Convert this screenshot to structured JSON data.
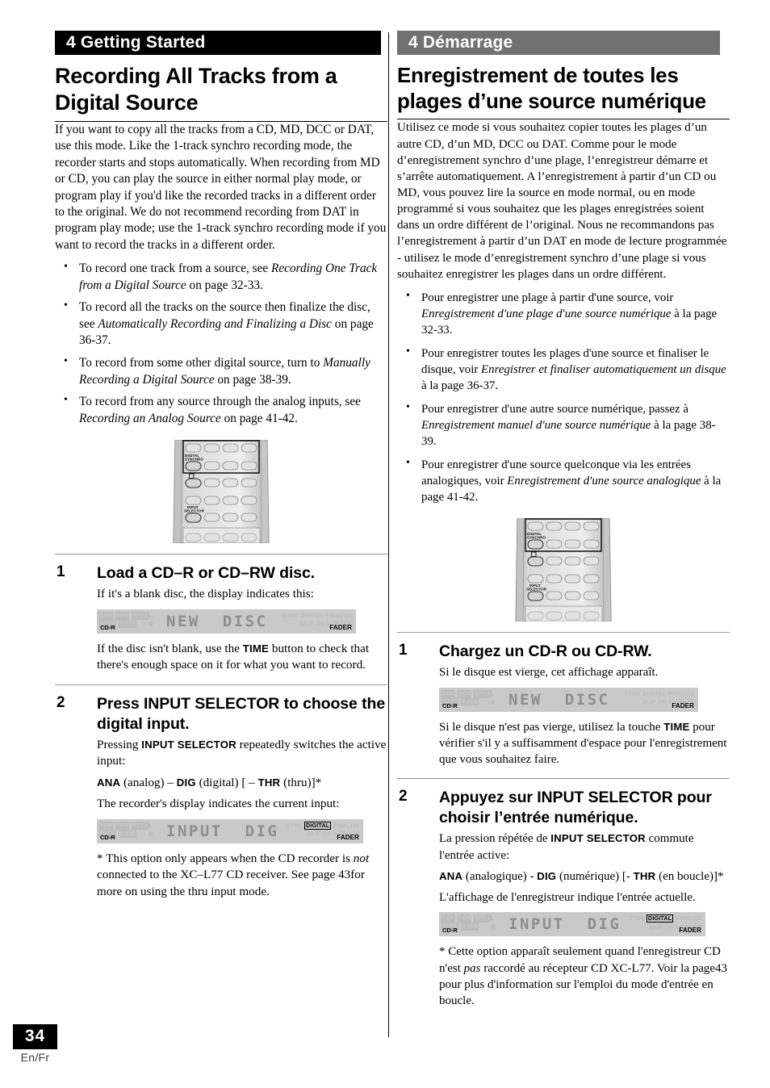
{
  "page": {
    "number": "34",
    "language_code": "En/Fr"
  },
  "columns": {
    "english": {
      "banner": "4 Getting Started",
      "banner_bg": "#000000",
      "title": "Recording All Tracks from a Digital Source",
      "intro": "If you want to copy all the tracks from a CD, MD, DCC or DAT, use this mode. Like the 1-track synchro recording mode, the recorder starts and stops automatically. When recording from MD or CD, you can play the source in either normal play mode, or program play if you'd like the recorded tracks in a different order to the original. We do not recommend recording from DAT in program play mode; use the 1-track synchro recording mode if you want to record the tracks in a different order.",
      "bullets": [
        {
          "pre": "To record one track from a source, see ",
          "italic": "Recording One Track from a Digital Source",
          "post": " on page 32-33."
        },
        {
          "pre": "To record all the tracks on the source then finalize the disc, see ",
          "italic": "Automatically Recording and Finalizing a Disc",
          "post": " on page 36-37."
        },
        {
          "pre": "To record from some other digital source, turn to ",
          "italic": "Manually Recording a Digital Source",
          "post": " on page 38-39."
        },
        {
          "pre": "To record from any source through the analog inputs, see ",
          "italic": "Recording an Analog Source",
          "post": " on page 41-42."
        }
      ],
      "steps": [
        {
          "number": "1",
          "title": "Load a CD–R or CD–RW disc.",
          "lead": "If it's a blank disc, the display indicates this:",
          "after_pre": "If the disc isn't blank, use the ",
          "after_bold": "TIME",
          "after_post": " button to check that there's enough space on it for what you want to record."
        },
        {
          "number": "2",
          "title": "Press INPUT SELECTOR to choose the digital input.",
          "lead_pre": "Pressing ",
          "lead_bold": "INPUT SELECTOR",
          "lead_post": " repeatedly switches the active input:",
          "sequence": {
            "ana": "ANA",
            "ana_note": " (analog) – ",
            "dig": "DIG",
            "dig_note": " (digital) [ – ",
            "thr": "THR",
            "thr_note": " (thru)]*"
          },
          "lead2": "The recorder's display indicates the current input:",
          "footnote_pre": "* This option only appears when the CD recorder is ",
          "footnote_italic": "not",
          "footnote_post": " connected to the XC–L77 CD receiver. See page 43for more on using the thru input mode."
        }
      ]
    },
    "french": {
      "banner": "4 Démarrage",
      "banner_bg": "#717171",
      "title": "Enregistrement de toutes les plages d’une source numérique",
      "intro": "Utilisez ce mode si vous souhaitez copier toutes les plages d’un autre CD, d’un MD, DCC ou DAT. Comme pour le mode d’enregistrement synchro d’une plage, l’enregistreur démarre et s’arrête automatiquement. A l’enregistrement à partir d’un CD ou MD, vous pouvez lire la source en mode normal, ou en mode programmé si vous souhaitez que les plages enregistrées soient dans un ordre différent de l’original. Nous ne recommandons pas l’enregistrement à partir d’un DAT en mode de lecture programmée - utilisez le mode d’enregistrement synchro d’une plage si vous souhaitez enregistrer les plages dans un ordre différent.",
      "bullets": [
        {
          "pre": "Pour enregistrer une plage à partir d'une source, voir ",
          "italic": "Enregistrement d'une plage d'une source numérique",
          "post": " à la page 32-33."
        },
        {
          "pre": "Pour enregistrer toutes les plages d'une source et finaliser le disque, voir ",
          "italic": "Enregistrer et finaliser automatiquement un disque",
          "post": " à la page 36-37."
        },
        {
          "pre": "Pour enregistrer d'une autre source numérique, passez à ",
          "italic": "Enregistrement manuel d'une source numérique",
          "post": " à la page 38-39."
        },
        {
          "pre": "Pour enregistrer d'une source quelconque via les entrées analogiques, voir ",
          "italic": "Enregistrement d'une source analogique",
          "post": " à la page 41-42."
        }
      ],
      "steps": [
        {
          "number": "1",
          "title": "Chargez un CD-R ou CD-RW.",
          "lead": "Si le disque est vierge, cet affichage apparaît.",
          "after_pre": "Si le disque n'est pas vierge, utilisez la touche ",
          "after_bold": "TIME",
          "after_post": " pour vérifier s'il y a suffisamment d'espace pour l'enregistrement que vous souhaitez faire."
        },
        {
          "number": "2",
          "title": "Appuyez sur INPUT SELECTOR pour choisir l’entrée numérique.",
          "lead_pre": "La pression répétée de ",
          "lead_bold": "INPUT SELECTOR",
          "lead_post": " commute l'entrée active:",
          "sequence": {
            "ana": "ANA",
            "ana_note": " (analogique) - ",
            "dig": "DIG",
            "dig_note": " (numérique) [- ",
            "thr": "THR",
            "thr_note": " (en boucle)]*"
          },
          "lead2": "L'affichage de l'enregistreur indique l'entrée actuelle.",
          "footnote_pre": "* Cette option apparaît seulement quand l'enregistreur CD n'est ",
          "footnote_italic": "pas",
          "footnote_post": " raccordé au récepteur CD XC-L77. Voir la page43 pour plus d'information sur l'emploi du mode d'entrée en boucle."
        }
      ]
    }
  },
  "remote": {
    "label_digital_synchro": "DIGITAL\nSYNCHRO",
    "label_input_selector": "INPUT\nSELECTOR"
  },
  "lcd_new_disc": {
    "main_text": "NEW  DISC",
    "cdr": "CD-R",
    "left_row1": [
      "RDM",
      "PGM",
      "RPT-1"
    ],
    "left_row2": [
      "AUTO",
      "D.VOL"
    ],
    "indicator_l": "L",
    "indicator_r": "R",
    "right_row1": "SYNC DIGITAL FINALIZE",
    "right_row2": "SKIP ON A.TRACK",
    "fader": "FADER",
    "digital_active": false
  },
  "lcd_input_dig": {
    "main_text": "INPUT  DIG",
    "cdr": "CD-R",
    "left_row1": [
      "RDM",
      "PGM",
      "RPT-1"
    ],
    "left_row2": [
      "AUTO",
      "D.VOL"
    ],
    "indicator_l": "L",
    "indicator_r": "R",
    "right_row1_pre": "SYNC ",
    "right_row1_digital": "DIGITAL",
    "right_row1_post": " FINALIZE",
    "right_row2": "SKIP ON A.TRACK",
    "fader": "FADER",
    "digital_active": true
  },
  "colors": {
    "banner_en": "#000000",
    "banner_fr": "#717171",
    "lcd_bg": "#c9c9c9",
    "lcd_dim": "#b4b4b4",
    "page_badge": "#000000"
  }
}
